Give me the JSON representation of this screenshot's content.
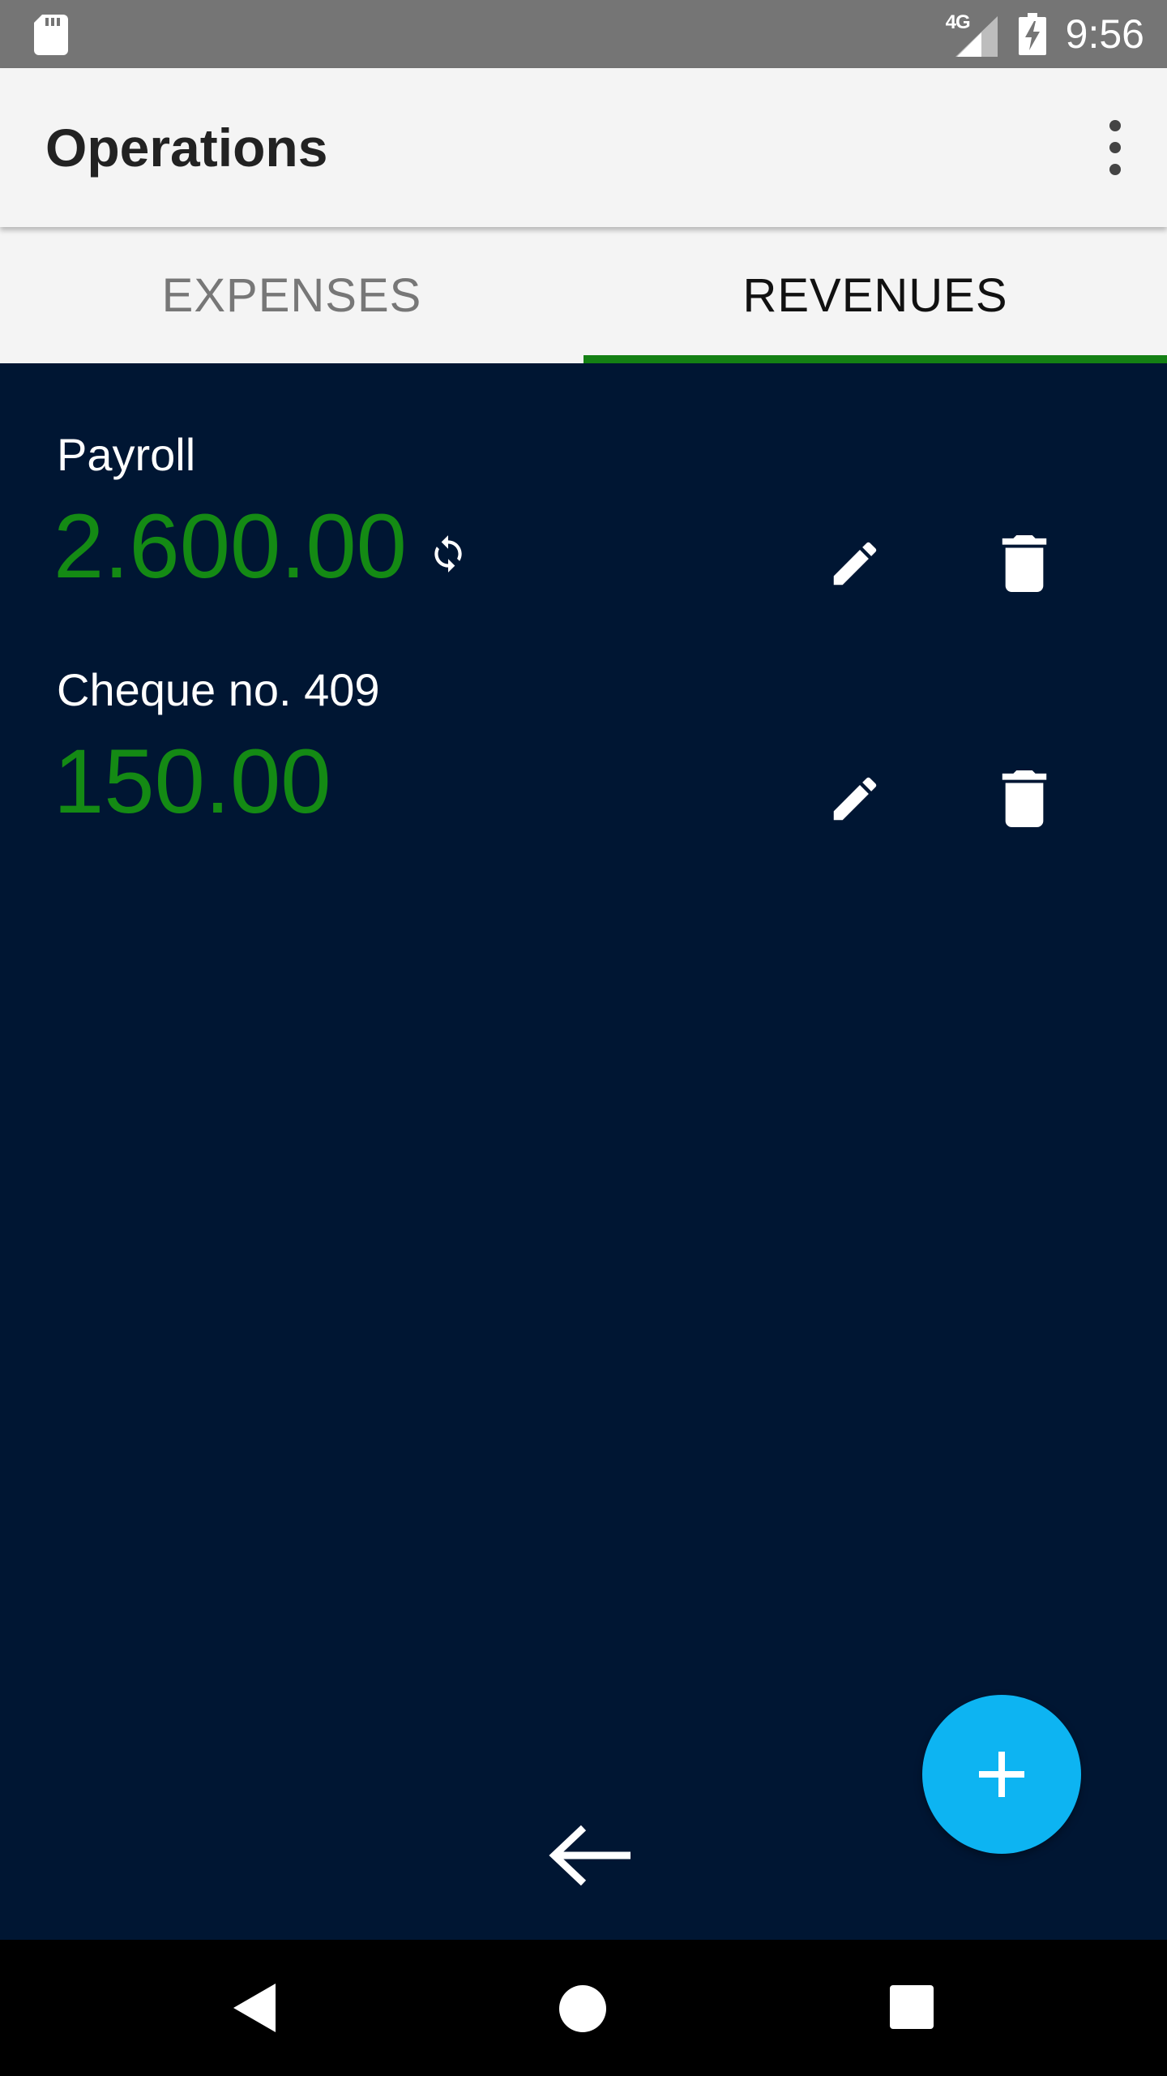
{
  "status_bar": {
    "network_label": "4G",
    "time": "9:56",
    "icons": [
      "sd-card-icon",
      "signal-icon",
      "battery-charging-icon"
    ]
  },
  "app_bar": {
    "title": "Operations",
    "menu_icon": "more-vert-icon"
  },
  "tabs": [
    {
      "label": "EXPENSES",
      "selected": false
    },
    {
      "label": "REVENUES",
      "selected": true
    }
  ],
  "colors": {
    "background": "#001633",
    "amount": "#148a14",
    "tab_indicator": "#148014",
    "fab": "#0db4f2"
  },
  "revenues": [
    {
      "name": "Payroll",
      "amount": "2.600.00",
      "recurring": true
    },
    {
      "name": "Cheque no. 409",
      "amount": "150.00",
      "recurring": false
    }
  ],
  "actions": {
    "edit_icon": "pencil-icon",
    "delete_icon": "trash-icon",
    "add_icon": "plus-icon",
    "back_icon": "arrow-left-icon"
  },
  "nav_bar": {
    "icons": [
      "nav-back-icon",
      "nav-home-icon",
      "nav-recents-icon"
    ]
  }
}
